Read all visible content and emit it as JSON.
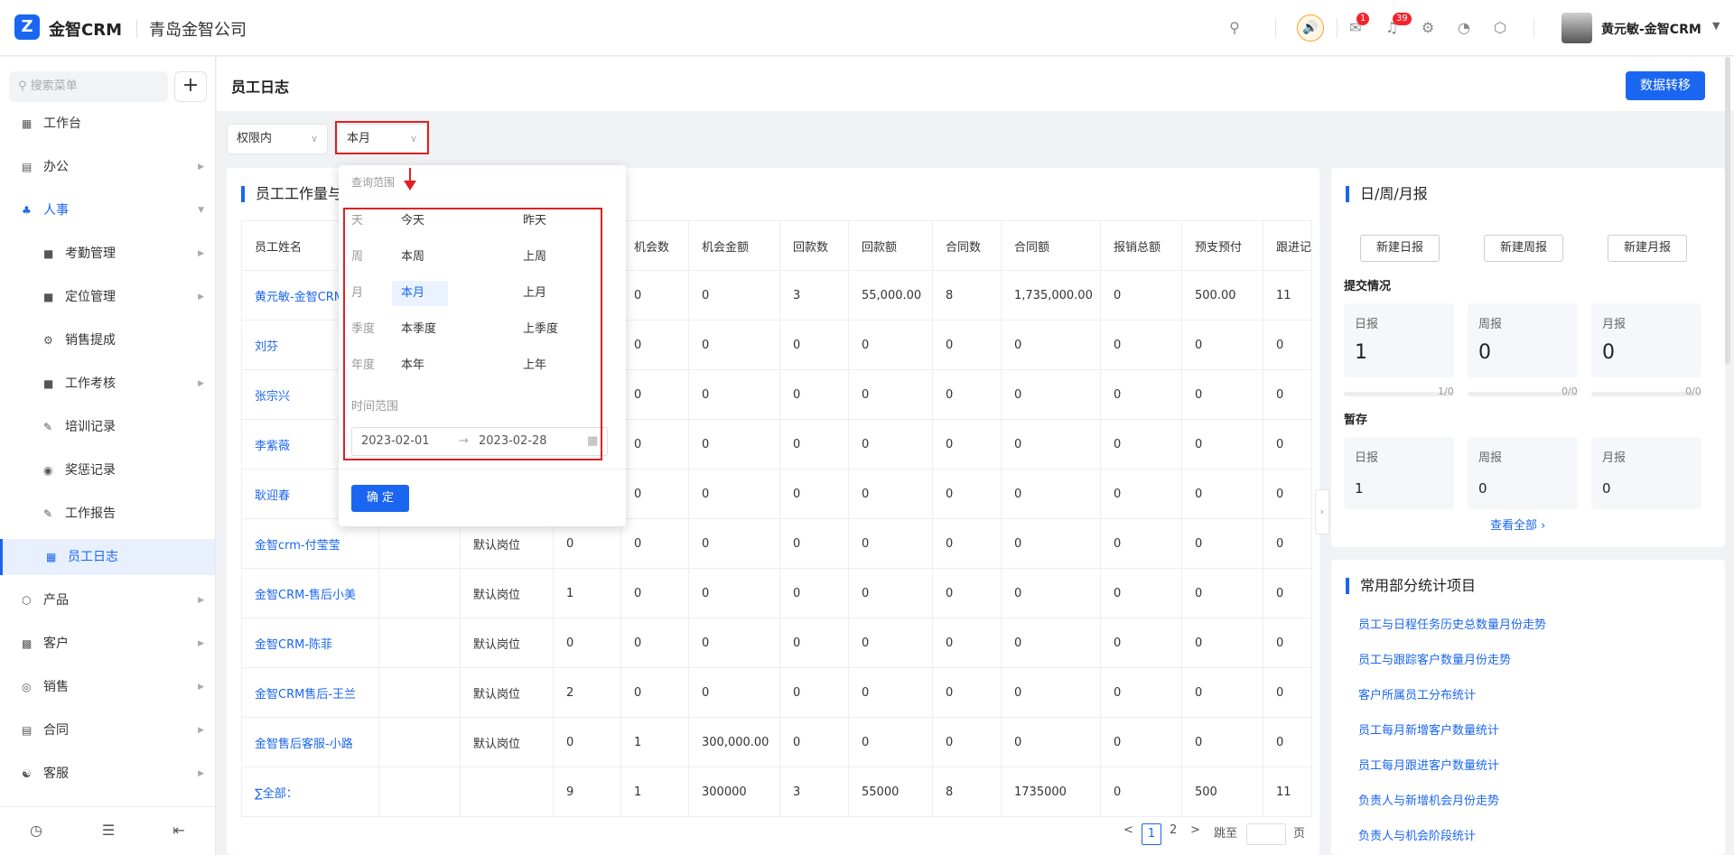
{
  "topbar": {
    "logo_glyph": "Z",
    "brand": "金智CRM",
    "company": "青岛金智公司",
    "mail_badge": "1",
    "bell_badge": "39",
    "user_name": "黄元敏-金智CRM"
  },
  "sidebar": {
    "search_placeholder": "搜索菜单",
    "plus_label": "+",
    "items": [
      {
        "label": "工作台",
        "icon": "dashboard-icon"
      },
      {
        "label": "办公",
        "icon": "office-icon"
      },
      {
        "label": "人事",
        "icon": "hr-icon"
      },
      {
        "label": "考勤管理",
        "icon": "folder-icon"
      },
      {
        "label": "定位管理",
        "icon": "folder-icon"
      },
      {
        "label": "销售提成",
        "icon": "gear-icon"
      },
      {
        "label": "工作考核",
        "icon": "folder-icon"
      },
      {
        "label": "培训记录",
        "icon": "edit-icon"
      },
      {
        "label": "奖惩记录",
        "icon": "medal-icon"
      },
      {
        "label": "工作报告",
        "icon": "edit-icon"
      },
      {
        "label": "员工日志",
        "icon": "log-icon"
      },
      {
        "label": "产品",
        "icon": "product-icon"
      },
      {
        "label": "客户",
        "icon": "customer-icon"
      },
      {
        "label": "销售",
        "icon": "sales-icon"
      },
      {
        "label": "合同",
        "icon": "contract-icon"
      },
      {
        "label": "客服",
        "icon": "service-icon"
      }
    ]
  },
  "header": {
    "title": "员工日志",
    "transfer_button": "数据转移"
  },
  "filters": {
    "scope": "权限内",
    "period": "本月"
  },
  "table": {
    "title": "员工工作量与",
    "columns": [
      "员工姓名",
      "",
      "",
      "",
      "机会数",
      "机会金额",
      "回款数",
      "回款额",
      "合同数",
      "合同额",
      "报销总额",
      "预支预付",
      "跟进记"
    ],
    "rows": [
      [
        "黄元敏-金智CRM",
        "",
        "",
        "",
        "0",
        "0",
        "3",
        "55,000.00",
        "8",
        "1,735,000.00",
        "0",
        "500.00",
        "11"
      ],
      [
        "刘芬",
        "",
        "",
        "",
        "0",
        "0",
        "0",
        "0",
        "0",
        "0",
        "0",
        "0",
        "0"
      ],
      [
        "张宗兴",
        "",
        "",
        "",
        "0",
        "0",
        "0",
        "0",
        "0",
        "0",
        "0",
        "0",
        "0"
      ],
      [
        "李紫薇",
        "",
        "",
        "",
        "0",
        "0",
        "0",
        "0",
        "0",
        "0",
        "0",
        "0",
        "0"
      ],
      [
        "耿迎春",
        "",
        "",
        "",
        "0",
        "0",
        "0",
        "0",
        "0",
        "0",
        "0",
        "0",
        "0"
      ],
      [
        "金智crm-付莹莹",
        "",
        "默认岗位",
        "0",
        "0",
        "0",
        "0",
        "0",
        "0",
        "0",
        "0",
        "0",
        "0"
      ],
      [
        "金智CRM-售后小美",
        "",
        "默认岗位",
        "1",
        "0",
        "0",
        "0",
        "0",
        "0",
        "0",
        "0",
        "0",
        "0"
      ],
      [
        "金智CRM-陈菲",
        "",
        "默认岗位",
        "0",
        "0",
        "0",
        "0",
        "0",
        "0",
        "0",
        "0",
        "0",
        "0"
      ],
      [
        "金智CRM售后-王兰",
        "",
        "默认岗位",
        "2",
        "0",
        "0",
        "0",
        "0",
        "0",
        "0",
        "0",
        "0",
        "0"
      ],
      [
        "金智售后客服-小路",
        "",
        "默认岗位",
        "0",
        "1",
        "300,000.00",
        "0",
        "0",
        "0",
        "0",
        "0",
        "0",
        "0"
      ],
      [
        "∑全部：",
        "",
        "",
        "9",
        "1",
        "300000",
        "3",
        "55000",
        "8",
        "1735000",
        "0",
        "500",
        "11"
      ]
    ]
  },
  "pagination": {
    "prev": "<",
    "page1": "1",
    "page2": "2",
    "next": ">",
    "goto": "跳至",
    "page_suffix": "页"
  },
  "dropdown": {
    "title": "查询范围",
    "rows": [
      {
        "label": "天",
        "opt1": "今天",
        "opt2": "昨天"
      },
      {
        "label": "周",
        "opt1": "本周",
        "opt2": "上周"
      },
      {
        "label": "月",
        "opt1": "本月",
        "opt2": "上月"
      },
      {
        "label": "季度",
        "opt1": "本季度",
        "opt2": "上季度"
      },
      {
        "label": "年度",
        "opt1": "本年",
        "opt2": "上年"
      }
    ],
    "range_label": "时间范围",
    "start_date": "2023-02-01",
    "arrow": "→",
    "end_date": "2023-02-28",
    "confirm": "确 定"
  },
  "reports": {
    "title": "日/周/月报",
    "new_daily": "新建日报",
    "new_weekly": "新建周报",
    "new_monthly": "新建月报",
    "submitted_title": "提交情况",
    "submitted": [
      {
        "label": "日报",
        "value": "1",
        "ratio": "1/0"
      },
      {
        "label": "周报",
        "value": "0",
        "ratio": "0/0"
      },
      {
        "label": "月报",
        "value": "0",
        "ratio": "0/0"
      }
    ],
    "draft_title": "暂存",
    "drafts": [
      {
        "label": "日报",
        "value": "1"
      },
      {
        "label": "周报",
        "value": "0"
      },
      {
        "label": "月报",
        "value": "0"
      }
    ],
    "view_all": "查看全部"
  },
  "stats": {
    "title": "常用部分统计项目",
    "links": [
      "员工与日程任务历史总数量月份走势",
      "员工与跟踪客户数量月份走势",
      "客户所属员工分布统计",
      "员工每月新增客户数量统计",
      "员工每月跟进客户数量统计",
      "负责人与新增机会月份走势",
      "负责人与机会阶段统计"
    ]
  }
}
